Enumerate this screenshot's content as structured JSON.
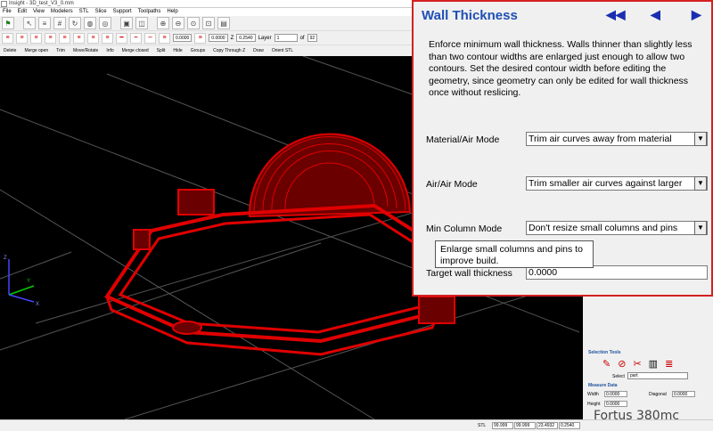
{
  "window": {
    "title": "Insight - 3D_test_V3_0.mm"
  },
  "menu": [
    "File",
    "Edit",
    "View",
    "Modelers",
    "STL",
    "Slice",
    "Support",
    "Toolpaths",
    "Help"
  ],
  "toolbar2": {
    "field1": "0.0000",
    "field2": "0.0000",
    "z_label": "Z",
    "z_value": "0.2540",
    "layer_label": "Layer",
    "layer_value": "1",
    "of_label": "of",
    "of_value": "92"
  },
  "toolbar3": [
    "Delete",
    "Merge open",
    "Trim",
    "Move/Rotate",
    "Info",
    "Merge closed",
    "Split",
    "Hide",
    "Groups",
    "Copy Through Z",
    "Draw",
    "Orient STL"
  ],
  "axes": {
    "x": "X",
    "y": "Y",
    "z": "Z"
  },
  "dialog": {
    "title": "Wall Thickness",
    "nav": {
      "first": "◀◀",
      "prev": "◀",
      "next": "▶"
    },
    "description": "Enforce minimum wall thickness. Walls thinner than slightly less than two contour widths are enlarged just enough to allow two contours. Set the desired contour width before editing the geometry, since geometry can only be edited for wall thickness once without reslicing.",
    "material_air_label": "Material/Air Mode",
    "material_air_value": "Trim air curves away from material",
    "air_air_label": "Air/Air Mode",
    "air_air_value": "Trim smaller air curves against larger",
    "min_column_label": "Min Column Mode",
    "min_column_value": "Don't resize small columns and pins",
    "target_label": "Target wall thickness",
    "target_value": "0.0000",
    "tooltip": "Enlarge small columns and pins to improve build."
  },
  "selection_tools": {
    "title": "Selection Tools",
    "select_label": "Select",
    "select_value": "part"
  },
  "measure": {
    "title": "Measure Data",
    "width_label": "Width",
    "width_value": "0.0000",
    "diagonal_label": "Diagonal",
    "diagonal_value": "0.0000",
    "height_label": "Height",
    "height_value": "0.0000"
  },
  "status": {
    "stl": "STL",
    "v1": "99.999",
    "v2": "99.999",
    "v3": "23.4932",
    "v4": "0.2540"
  },
  "printer": "Fortus 380mc",
  "colors": {
    "accent": "#1f4fb5",
    "dialog_border": "#d42020",
    "model": "#e00000"
  }
}
